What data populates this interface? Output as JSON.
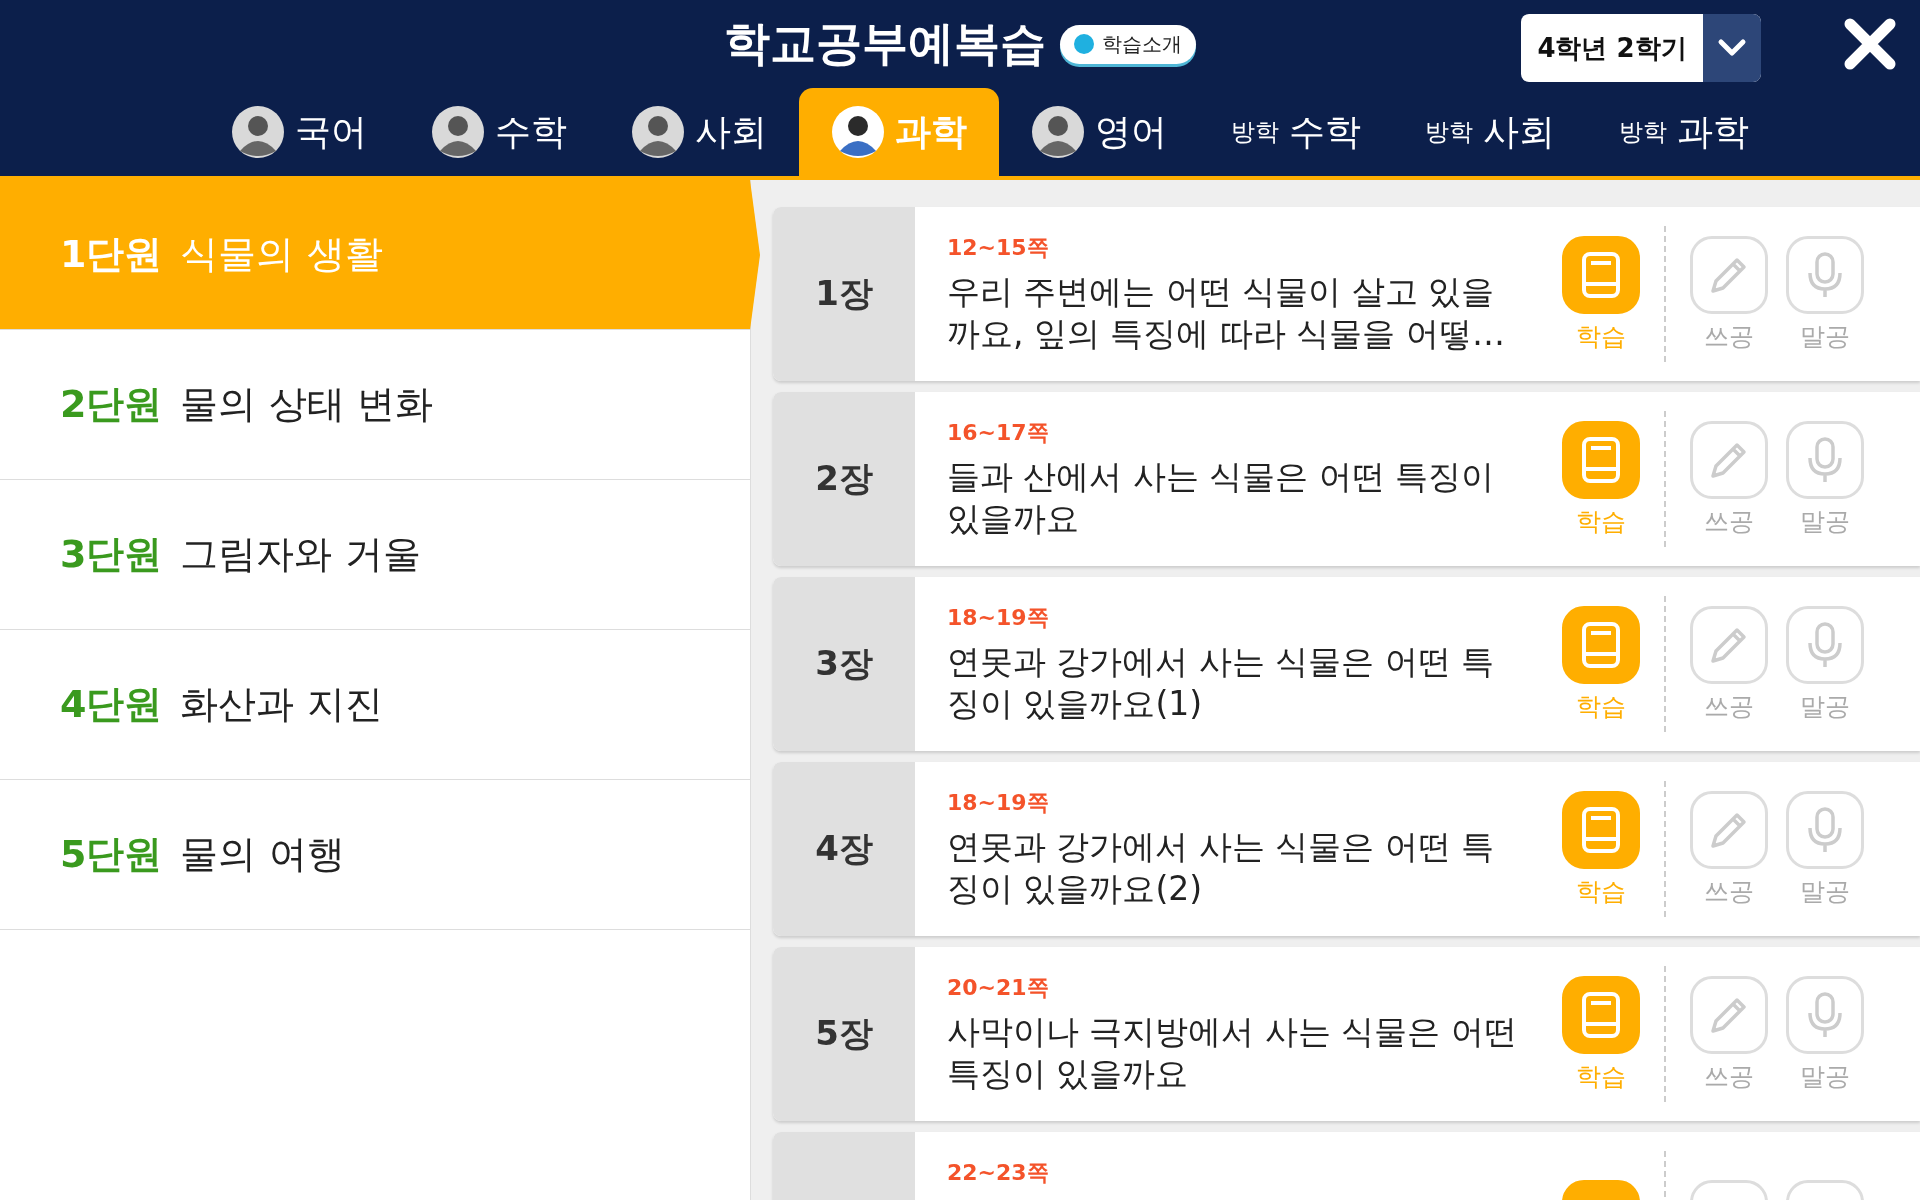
{
  "header": {
    "title": "학교공부예복습",
    "intro_badge": "학습소개",
    "grade_select": "4학년 2학기"
  },
  "tabs": [
    {
      "kind": "avatar",
      "label": "국어",
      "selected": false
    },
    {
      "kind": "avatar",
      "label": "수학",
      "selected": false
    },
    {
      "kind": "avatar",
      "label": "사회",
      "selected": false
    },
    {
      "kind": "avatar",
      "label": "과학",
      "selected": true
    },
    {
      "kind": "avatar",
      "label": "영어",
      "selected": false
    },
    {
      "kind": "vacation",
      "prefix": "방학",
      "label": "수학",
      "selected": false
    },
    {
      "kind": "vacation",
      "prefix": "방학",
      "label": "사회",
      "selected": false
    },
    {
      "kind": "vacation",
      "prefix": "방학",
      "label": "과학",
      "selected": false
    }
  ],
  "units": [
    {
      "number": "1단원",
      "title": "식물의 생활",
      "selected": true
    },
    {
      "number": "2단원",
      "title": "물의 상태 변화",
      "selected": false
    },
    {
      "number": "3단원",
      "title": "그림자와 거울",
      "selected": false
    },
    {
      "number": "4단원",
      "title": "화산과 지진",
      "selected": false
    },
    {
      "number": "5단원",
      "title": "물의 여행",
      "selected": false
    }
  ],
  "chapters": [
    {
      "chapter": "1장",
      "pages": "12~15쪽",
      "title": "우리 주변에는 어떤 식물이 살고 있을까요, 잎의 특징에 따라 식물을 어떻…",
      "buttons": [
        {
          "kind": "book",
          "label": "학습",
          "enabled": true
        },
        {
          "kind": "pencil",
          "label": "쓰공",
          "enabled": false
        },
        {
          "kind": "mic",
          "label": "말공",
          "enabled": false
        }
      ]
    },
    {
      "chapter": "2장",
      "pages": "16~17쪽",
      "title": "들과 산에서 사는 식물은 어떤 특징이 있을까요",
      "buttons": [
        {
          "kind": "book",
          "label": "학습",
          "enabled": true
        },
        {
          "kind": "pencil",
          "label": "쓰공",
          "enabled": false
        },
        {
          "kind": "mic",
          "label": "말공",
          "enabled": false
        }
      ]
    },
    {
      "chapter": "3장",
      "pages": "18~19쪽",
      "title": "연못과 강가에서 사는 식물은 어떤 특징이 있을까요(1)",
      "buttons": [
        {
          "kind": "book",
          "label": "학습",
          "enabled": true
        },
        {
          "kind": "pencil",
          "label": "쓰공",
          "enabled": false
        },
        {
          "kind": "mic",
          "label": "말공",
          "enabled": false
        }
      ]
    },
    {
      "chapter": "4장",
      "pages": "18~19쪽",
      "title": "연못과 강가에서 사는 식물은 어떤 특징이 있을까요(2)",
      "buttons": [
        {
          "kind": "book",
          "label": "학습",
          "enabled": true
        },
        {
          "kind": "pencil",
          "label": "쓰공",
          "enabled": false
        },
        {
          "kind": "mic",
          "label": "말공",
          "enabled": false
        }
      ]
    },
    {
      "chapter": "5장",
      "pages": "20~21쪽",
      "title": "사막이나 극지방에서 사는 식물은 어떤 특징이 있을까요",
      "buttons": [
        {
          "kind": "book",
          "label": "학습",
          "enabled": true
        },
        {
          "kind": "pencil",
          "label": "쓰공",
          "enabled": false
        },
        {
          "kind": "mic",
          "label": "말공",
          "enabled": false
        }
      ]
    },
    {
      "pages": "22~23쪽",
      "buttons": [
        {
          "kind": "book",
          "enabled": true
        },
        {
          "kind": "pencil",
          "enabled": false
        },
        {
          "kind": "mic",
          "enabled": false
        }
      ]
    }
  ]
}
